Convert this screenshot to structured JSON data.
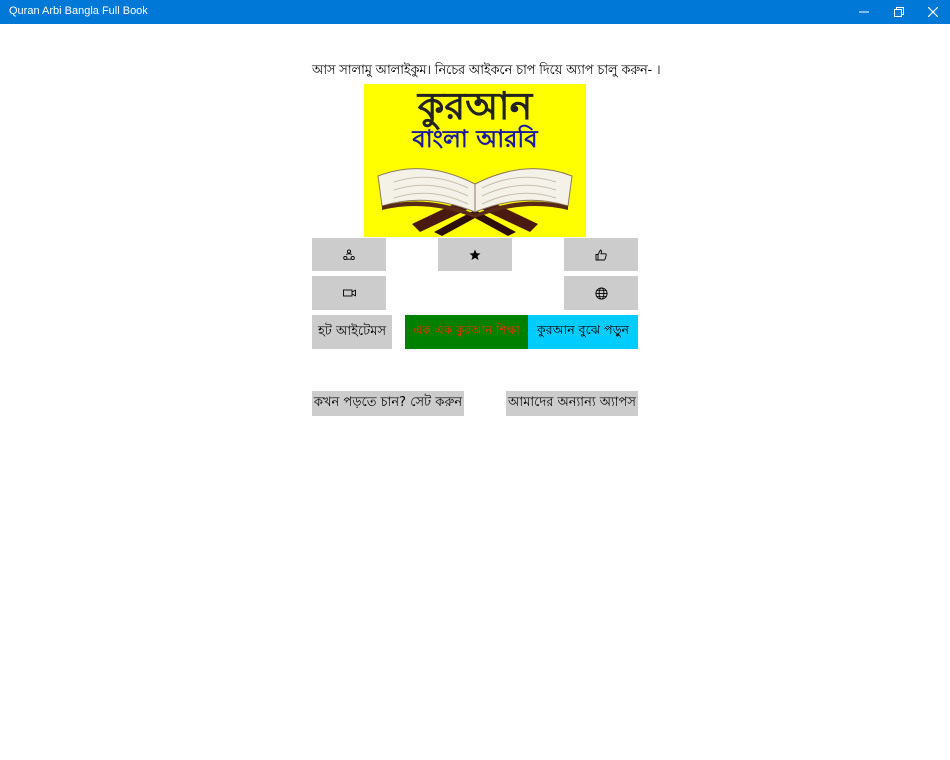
{
  "window": {
    "title": "Quran Arbi Bangla Full Book",
    "controls": [
      "minimize-icon",
      "restore-icon",
      "close-icon"
    ],
    "titlebar_color": "#0078d7"
  },
  "main": {
    "greeting": "আস সালামু আলাইকুম। নিচের আইকনে চাপ দিয়ে অ্যাপ চালু করুন- ।",
    "logo": {
      "title": "কুরআন",
      "subtitle": "বাংলা আরবি",
      "background": "#ffff00"
    },
    "icon_buttons": [
      {
        "name": "share-button",
        "icon": "share-icon"
      },
      {
        "name": "rate-button",
        "icon": "star-icon"
      },
      {
        "name": "like-button",
        "icon": "thumbs-up-icon"
      },
      {
        "name": "video-button",
        "icon": "video-icon"
      },
      {
        "name": "web-button",
        "icon": "globe-icon"
      }
    ],
    "hot_items_label": "হট আইটেমস",
    "green_button_label": "এক এক কুরআন শিক্ষা",
    "cyan_button_label": "কুরআন বুঝে পড়ুন",
    "reminder_label": "কখন পড়তে চান? সেট করুন",
    "other_apps_label": "আমাদের অন্যান্য অ্যাপস",
    "colors": {
      "button_gray": "#cccccc",
      "green": "#008000",
      "cyan": "#00ccff",
      "green_text": "#ff2a00"
    }
  }
}
